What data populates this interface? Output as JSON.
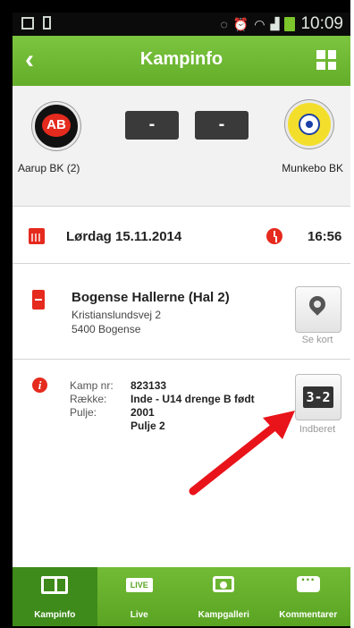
{
  "status_bar": {
    "time": "10:09"
  },
  "app_bar": {
    "title": "Kampinfo",
    "back_icon": "back-arrow-icon",
    "menu_icon": "grid-menu-icon"
  },
  "match": {
    "home_team": "Aarup BK (2)",
    "away_team": "Munkebo BK",
    "home_score": "-",
    "away_score": "-",
    "home_logo_text": "AB"
  },
  "schedule": {
    "date": "Lørdag 15.11.2014",
    "time": "16:56"
  },
  "venue": {
    "name": "Bogense Hallerne (Hal 2)",
    "address_line1": "Kristianslundsvej 2",
    "address_line2": "5400 Bogense",
    "map_button_label": "Se kort"
  },
  "details": {
    "kamp_nr_label": "Kamp nr:",
    "kamp_nr_value": "823133",
    "raekke_label": "Række:",
    "raekke_value": "Inde - U14 drenge B født",
    "pulje_label": "Pulje:",
    "pulje_value_line1": "2001",
    "pulje_value_line2": "Pulje 2",
    "report_button_label": "Indberet",
    "report_button_glyph": "3-2"
  },
  "annotation": {
    "arrow_color": "#e8141a"
  },
  "tabs": [
    {
      "label": "Kampinfo",
      "icon": "field-icon",
      "active": true
    },
    {
      "label": "Live",
      "icon": "live-icon",
      "icon_text": "LIVE",
      "active": false
    },
    {
      "label": "Kampgalleri",
      "icon": "camera-icon",
      "active": false
    },
    {
      "label": "Kommentarer",
      "icon": "chat-icon",
      "active": false
    }
  ],
  "colors": {
    "brand_green": "#6ab830",
    "accent_red": "#e52a1e",
    "score_box": "#3a3a3a"
  }
}
